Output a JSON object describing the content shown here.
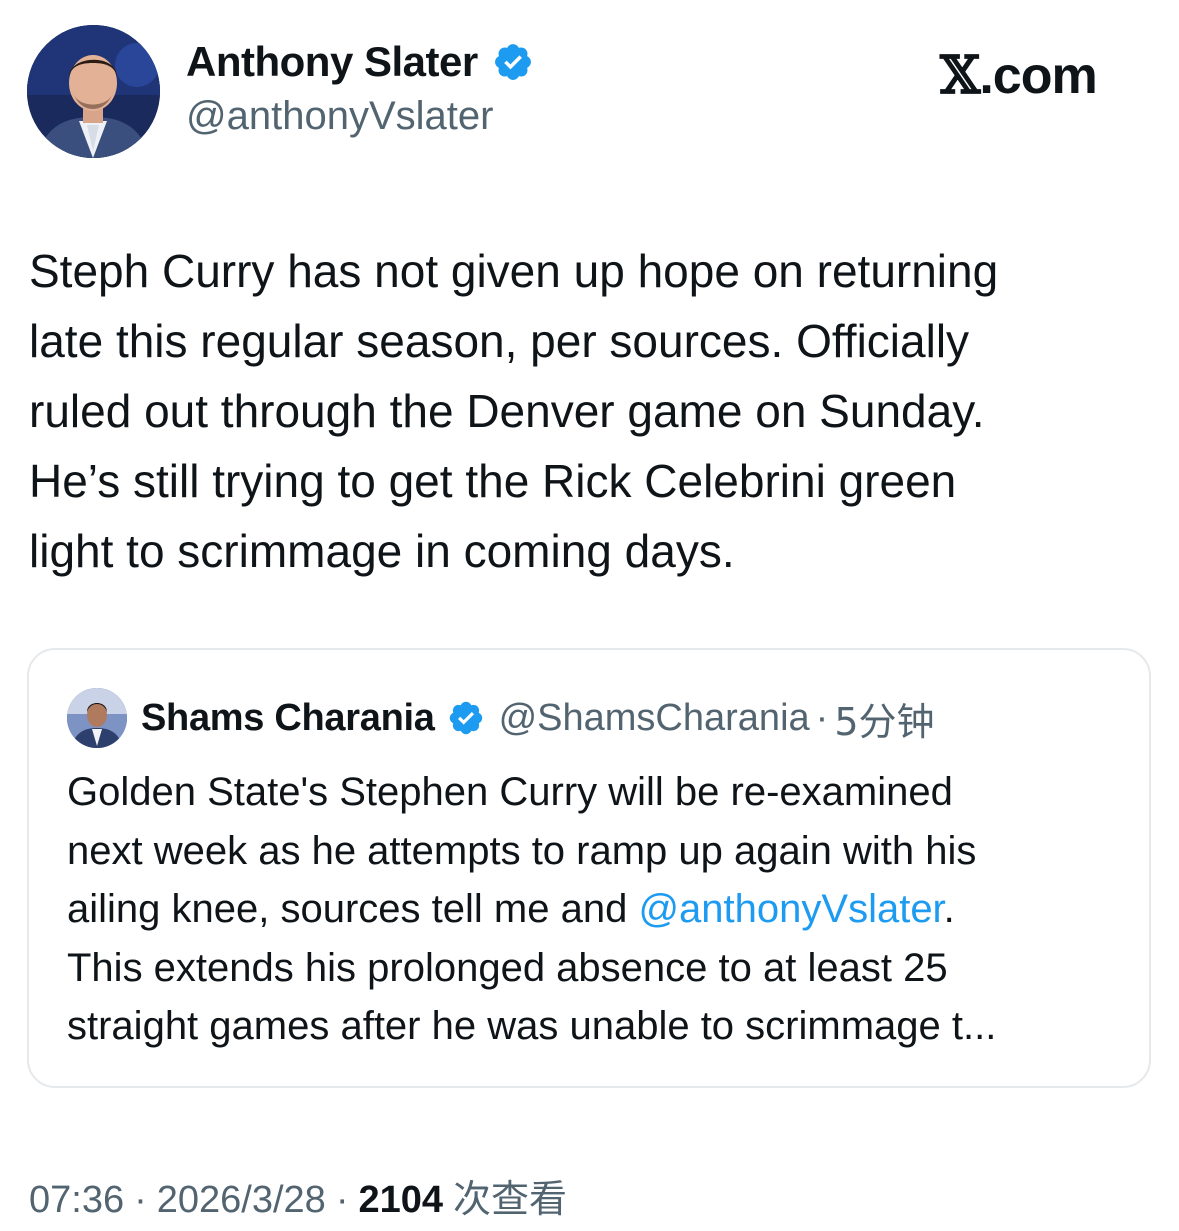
{
  "author": {
    "name": "Anthony Slater",
    "handle": "@anthonyVslater",
    "verified_icon": "verified-badge-icon"
  },
  "brand": {
    "x_mark": "𝕏",
    "suffix": ".com"
  },
  "tweet": {
    "lines": [
      "Steph Curry has not given up hope on returning",
      "late this regular season, per sources. Officially",
      "ruled out through the Denver game on Sunday.",
      "He’s still trying to get the Rick Celebrini green",
      "light to scrimmage in coming days."
    ]
  },
  "quote": {
    "name": "Shams Charania",
    "handle": "@ShamsCharania",
    "separator": "·",
    "time": "5分钟",
    "line1": "Golden State's Stephen Curry will be re-examined",
    "line2": "next week as he attempts to ramp up again with his",
    "line3_before": "ailing knee, sources tell me and ",
    "line3_mention": "@anthonyVslater",
    "line3_after": ".",
    "line4": "This extends his prolonged absence to at least 25",
    "line5": "straight games after he was unable to scrimmage t..."
  },
  "meta": {
    "time": "07:36",
    "date": "2026/3/28",
    "separator": "·",
    "views_count": "2104",
    "views_label": "次查看"
  },
  "colors": {
    "text": "#0f1419",
    "secondary": "#536471",
    "link": "#1d9bf0",
    "verified": "#1d9bf0",
    "border": "#e6e9ec"
  }
}
